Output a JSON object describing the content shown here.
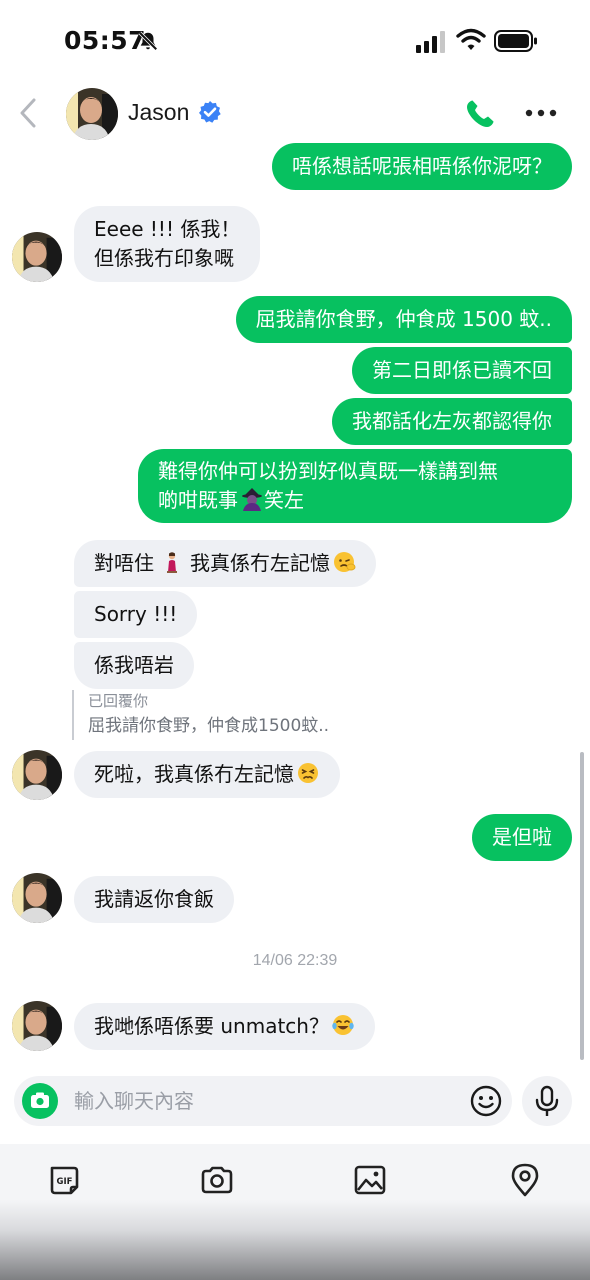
{
  "status_bar": {
    "time": "05:57"
  },
  "header": {
    "contact_name": "Jason"
  },
  "messages": [
    {
      "dir": "out",
      "text": "唔係想話呢張相唔係你泥呀？"
    },
    {
      "dir": "in",
      "line1": "Eeee !!! 係我！",
      "line2": "但係我冇印象嘅"
    },
    {
      "dir": "out",
      "text": "屈我請你食野，仲食成 1500 蚊.."
    },
    {
      "dir": "out",
      "text": "第二日即係已讀不回"
    },
    {
      "dir": "out",
      "text": "我都話化左灰都認得你"
    },
    {
      "dir": "out",
      "line1": "難得你仲可以扮到好似真既一樣講到無",
      "line2a": "啲咁既事",
      "line2b": "笑左"
    },
    {
      "dir": "in",
      "a": "對唔住",
      "b": "我真係冇左記憶"
    },
    {
      "dir": "in",
      "text": "Sorry !!!"
    },
    {
      "dir": "in",
      "text": "係我唔岩"
    },
    {
      "dir": "in",
      "text": "死啦，我真係冇左記憶"
    },
    {
      "dir": "out",
      "text": "是但啦"
    },
    {
      "dir": "in",
      "text": "我請返你食飯"
    },
    {
      "dir": "in",
      "text": "我哋係唔係要 unmatch？"
    }
  ],
  "reply_quote": {
    "label": "已回覆你",
    "text": "屈我請你食野，仲食成1500蚊.."
  },
  "timestamp": "14/06 22:39",
  "input": {
    "placeholder": "輸入聊天內容"
  },
  "toolbar": {
    "gif_label": "GIF"
  },
  "colors": {
    "accent": "#07c160",
    "incoming_bubble": "#eef0f4",
    "verified": "#3b82f6"
  },
  "icons": [
    "back-icon",
    "verified-icon",
    "phone-icon",
    "more-icon",
    "camera-icon",
    "emoji-icon",
    "mic-icon",
    "gif-icon",
    "image-icon",
    "location-icon"
  ]
}
